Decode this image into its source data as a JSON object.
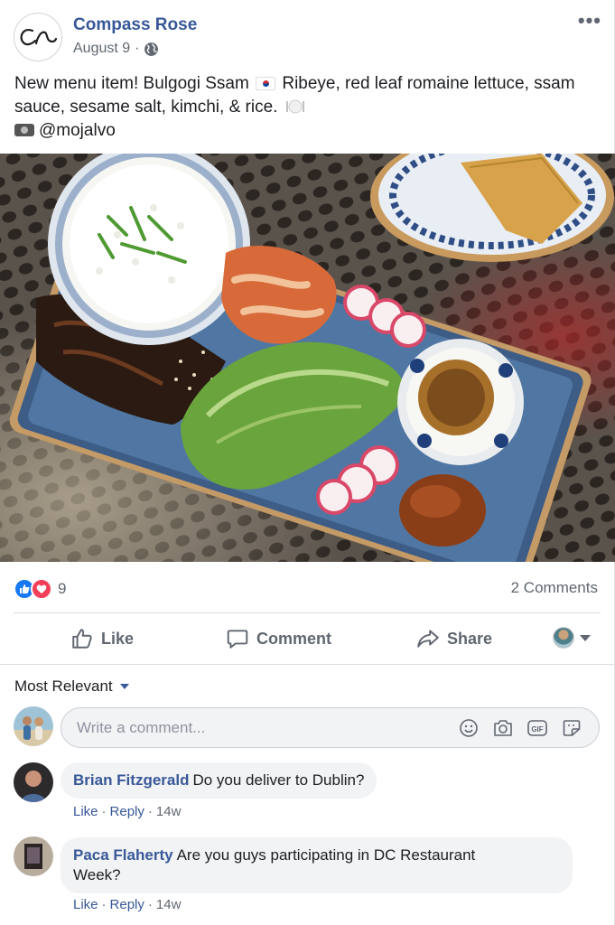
{
  "post": {
    "page_name": "Compass Rose",
    "date": "August 9",
    "date_separator": "·",
    "text_lines": [
      {
        "before": "New menu item! Bulgogi Ssam",
        "after": "Ribeye, red leaf romaine lettuce, ssam"
      },
      {
        "text": "sauce, sesame salt, kimchi, & rice."
      },
      {
        "text": "@mojalvo"
      }
    ],
    "logo_text": "cr"
  },
  "engagement": {
    "reaction_count": "9",
    "comments_count": "2 Comments"
  },
  "actions": {
    "like": "Like",
    "comment": "Comment",
    "share": "Share"
  },
  "comments_section": {
    "sort_label": "Most Relevant",
    "composer_placeholder": "Write a comment...",
    "items": [
      {
        "author": "Brian Fitzgerald",
        "text": "Do you deliver to Dublin?",
        "like": "Like",
        "reply": "Reply",
        "time": "14w"
      },
      {
        "author": "Paca Flaherty",
        "text": "Are you guys participating in DC Restaurant",
        "text2": "Week?",
        "like": "Like",
        "reply": "Reply",
        "time": "14w"
      }
    ]
  },
  "colors": {
    "link": "#385898",
    "secondary_text": "#606770",
    "like_blue": "#1877f2",
    "love_red": "#f33e58"
  }
}
